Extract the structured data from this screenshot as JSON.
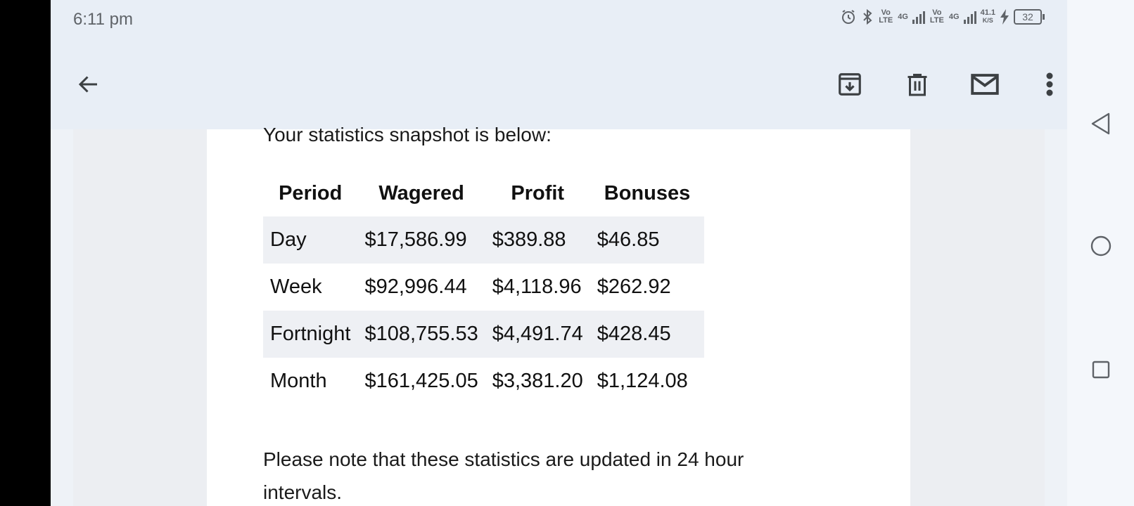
{
  "status_bar": {
    "time": "6:11 pm",
    "volte1": "Vo LTE",
    "net1": "4G",
    "volte2": "Vo LTE",
    "net2": "4G",
    "speed": "41.1",
    "speed_unit": "K/S",
    "battery": "32"
  },
  "email": {
    "intro": "Your statistics snapshot is below:",
    "table": {
      "headers": [
        "Period",
        "Wagered",
        "Profit",
        "Bonuses"
      ],
      "rows": [
        [
          "Day",
          "$17,586.99",
          "$389.88",
          "$46.85"
        ],
        [
          "Week",
          "$92,996.44",
          "$4,118.96",
          "$262.92"
        ],
        [
          "Fortnight",
          "$108,755.53",
          "$4,491.74",
          "$428.45"
        ],
        [
          "Month",
          "$161,425.05",
          "$3,381.20",
          "$1,124.08"
        ]
      ]
    },
    "note": "Please note that these statistics are updated in 24 hour intervals."
  },
  "colors": {
    "toolbar_bg": "#e8eef6",
    "row_shade": "#eef0f4",
    "icon": "#3c4043"
  }
}
